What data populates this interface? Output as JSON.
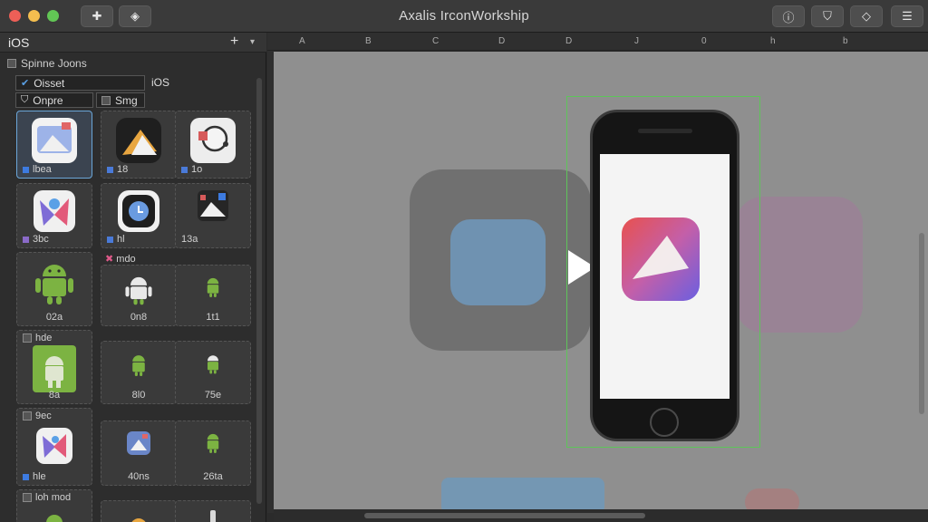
{
  "window": {
    "title": "Axalis IrconWorkship",
    "toolbar_left": [
      {
        "name": "add-icon",
        "glyph": "✚"
      },
      {
        "name": "tint-icon",
        "glyph": "◈"
      }
    ],
    "toolbar_right": [
      {
        "name": "info-icon",
        "glyph": "ⓘ"
      },
      {
        "name": "shield-icon",
        "glyph": "⛉"
      },
      {
        "name": "layers-icon",
        "glyph": "◇"
      },
      {
        "name": "panel-icon",
        "glyph": "☰"
      }
    ]
  },
  "sidebar": {
    "header_label": "iOS",
    "add_glyph": "+",
    "caret_glyph": "▾",
    "section_title": "Spinne Joons",
    "filter_asset": "Oisset",
    "filter_onpre": "Onpre",
    "filter_smg": "Smg",
    "platform_label": "iOS",
    "items": [
      {
        "cap": "lbea",
        "color": "#3d7be0"
      },
      {
        "cap": "18",
        "color": "#4a7ad8"
      },
      {
        "cap": "1o",
        "color": "#4a7ad8"
      },
      {
        "cap": "3bc",
        "color": "#8a6ac8"
      },
      {
        "cap": "hl",
        "color": "#4a7ad8"
      },
      {
        "cap": "13a",
        "color": "#8a6ac8"
      },
      {
        "cap": "02a",
        "color": ""
      },
      {
        "cap": "0n8",
        "color": ""
      },
      {
        "cap": "1t1",
        "color": ""
      },
      {
        "cap": "8a",
        "color": ""
      },
      {
        "cap": "8l0",
        "color": ""
      },
      {
        "cap": "75e",
        "color": ""
      },
      {
        "cap": "hle",
        "color": "#3d7be0"
      },
      {
        "cap": "40ns",
        "color": ""
      },
      {
        "cap": "26ta",
        "color": ""
      }
    ],
    "group_labels": {
      "mdo": "mdo",
      "hde": "hde",
      "sec": "9ec",
      "bot": "loh mod"
    }
  },
  "ruler": {
    "ticks": [
      "A",
      "B",
      "C",
      "D",
      "D",
      "J",
      "0",
      "h",
      "b"
    ]
  },
  "colors": {
    "accent": "#5ec45a",
    "selection": "#6ba6d8"
  }
}
